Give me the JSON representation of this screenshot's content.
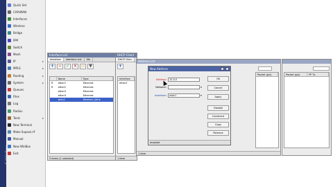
{
  "side_label": "S Winbox",
  "menu": [
    {
      "label": "Quick Set",
      "icon": "quick-set-icon",
      "color": "#5b7bd4",
      "sub": false
    },
    {
      "label": "CAPsMAN",
      "icon": "capsman-icon",
      "color": "#6a6a6a",
      "sub": false
    },
    {
      "label": "Interfaces",
      "icon": "interfaces-icon",
      "color": "#3a8a3a",
      "sub": false
    },
    {
      "label": "Wireless",
      "icon": "wireless-icon",
      "color": "#3a6ac4",
      "sub": false
    },
    {
      "label": "Bridge",
      "icon": "bridge-icon",
      "color": "#3a8a8a",
      "sub": false
    },
    {
      "label": "PPP",
      "icon": "ppp-icon",
      "color": "#4a4ac4",
      "sub": false
    },
    {
      "label": "Switch",
      "icon": "switch-icon",
      "color": "#6a8a3a",
      "sub": false
    },
    {
      "label": "Mesh",
      "icon": "mesh-icon",
      "color": "#8a4a8a",
      "sub": false
    },
    {
      "label": "IP",
      "icon": "ip-icon",
      "color": "#5a5a9a",
      "sub": true
    },
    {
      "label": "MPLS",
      "icon": "mpls-icon",
      "color": "#4a7ab4",
      "sub": true
    },
    {
      "label": "Routing",
      "icon": "routing-icon",
      "color": "#c47a3a",
      "sub": true
    },
    {
      "label": "System",
      "icon": "system-icon",
      "color": "#6a6a6a",
      "sub": true
    },
    {
      "label": "Queues",
      "icon": "queues-icon",
      "color": "#c43a3a",
      "sub": false
    },
    {
      "label": "Files",
      "icon": "files-icon",
      "color": "#3a6ab4",
      "sub": false
    },
    {
      "label": "Log",
      "icon": "log-icon",
      "color": "#7a7a7a",
      "sub": false
    },
    {
      "label": "Radius",
      "icon": "radius-icon",
      "color": "#4a9a6a",
      "sub": false
    },
    {
      "label": "Tools",
      "icon": "tools-icon",
      "color": "#9a6a3a",
      "sub": true
    },
    {
      "label": "New Terminal",
      "icon": "terminal-icon",
      "color": "#2a2a2a",
      "sub": false
    },
    {
      "label": "Make Supout.rif",
      "icon": "supout-icon",
      "color": "#5a8ab4",
      "sub": false
    },
    {
      "label": "Manual",
      "icon": "manual-icon",
      "color": "#3a5aa4",
      "sub": false
    },
    {
      "label": "New WinBox",
      "icon": "winbox-icon",
      "color": "#3a7ac4",
      "sub": false
    },
    {
      "label": "Exit",
      "icon": "exit-icon",
      "color": "#c43a3a",
      "sub": false
    }
  ],
  "interface_window": {
    "title": "Interface List",
    "tabs": [
      "Interface",
      "Interface List",
      "Eth"
    ],
    "columns": [
      "Name",
      "Type"
    ],
    "rows": [
      {
        "flag": "R",
        "name": "ether1",
        "type": "Ethernet",
        "selected": false
      },
      {
        "flag": "R",
        "name": "ether2",
        "type": "Ethernet",
        "selected": false
      },
      {
        "flag": "",
        "name": "ether3",
        "type": "Ethernet",
        "selected": false
      },
      {
        "flag": "",
        "name": "ether4",
        "type": "Ethernet",
        "selected": false
      },
      {
        "flag": "",
        "name": "wlan1",
        "type": "Wireless (Athe",
        "selected": true
      }
    ],
    "status": "5 items (1 selected)"
  },
  "dhcp_window": {
    "title": "DHCP Client",
    "tabs": [
      "DHCP Clien"
    ],
    "columns": [
      "Interface"
    ],
    "rows": [
      {
        "value": "ether1"
      }
    ],
    "status": "1 item"
  },
  "address_window": {
    "title": "Address List",
    "status": "1 item",
    "columns": [
      "Packet (p/s)",
      "FP Tx"
    ]
  },
  "dialog": {
    "title": "New Address",
    "fields": [
      {
        "label": "Address:",
        "value": "10.0.0",
        "style": "red"
      },
      {
        "label": "Network:",
        "value": "",
        "style": "normal"
      },
      {
        "label": "Interface:",
        "value": "wlan1",
        "style": "blue"
      }
    ],
    "buttons": [
      "OK",
      "Cancel",
      "Apply",
      "Disable",
      "Comment",
      "Copy",
      "Remove"
    ],
    "status": "enabled"
  }
}
